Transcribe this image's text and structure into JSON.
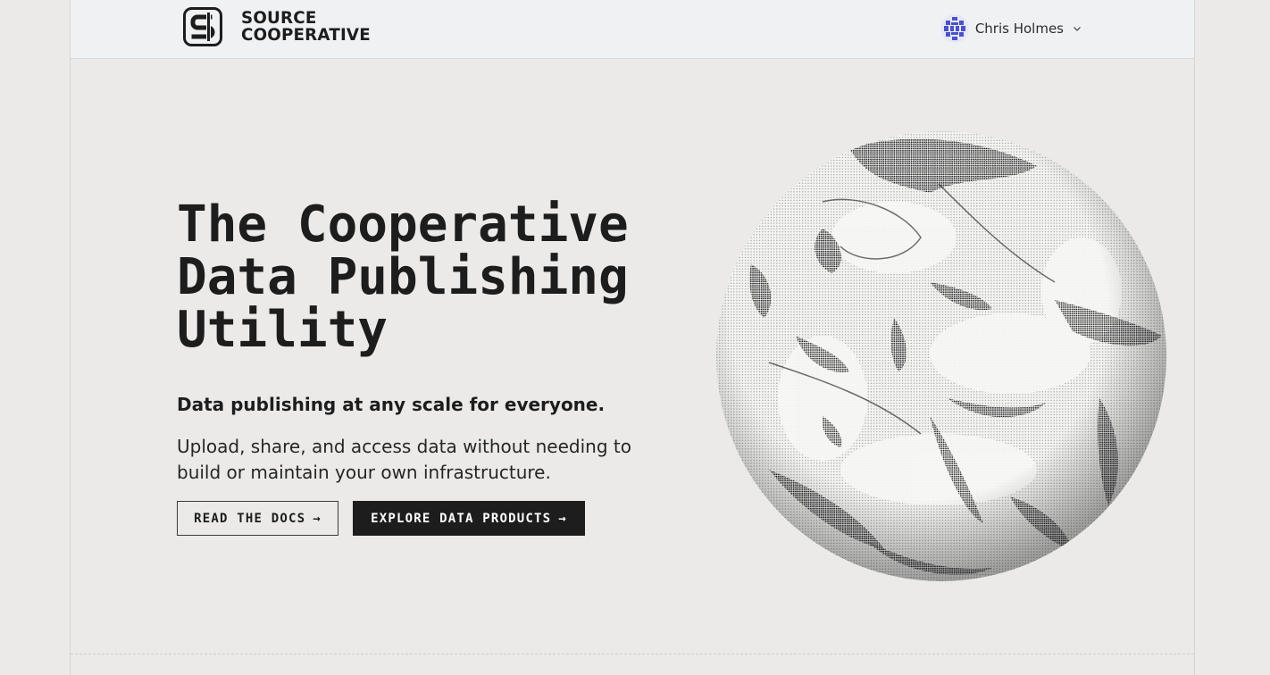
{
  "header": {
    "logo_line1": "SOURCE",
    "logo_line2": "COOPERATIVE",
    "user_name": "Chris Holmes",
    "user_menu_icon": "chevron-down-icon",
    "avatar_icon": "identicon-avatar"
  },
  "hero": {
    "title_line1": "The Cooperative",
    "title_line2": "Data Publishing",
    "title_line3": "Utility",
    "tagline": "Data publishing at any scale for everyone.",
    "description": "Upload, share, and access data without needing to build or maintain your own infrastructure.",
    "read_docs_label": "READ THE DOCS",
    "explore_label": "EXPLORE DATA PRODUCTS",
    "arrow": "→",
    "image": "halftone-earth-globe"
  },
  "colors": {
    "page_bg": "#ebeae9",
    "header_bg": "#f0f1f3",
    "text": "#1d1d1d",
    "avatar": "#4a52c9"
  }
}
